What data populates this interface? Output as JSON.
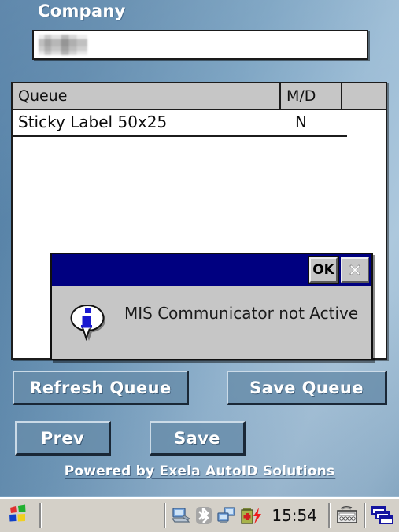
{
  "app": {
    "company": {
      "label": "Company",
      "value": "",
      "value_redacted": true
    },
    "queue_table": {
      "columns": [
        "Queue",
        "M/D",
        ""
      ],
      "rows": [
        {
          "queue": "Sticky Label 50x25",
          "md": "N",
          "extra": ""
        }
      ]
    },
    "dialog": {
      "title": "",
      "message": "MIS Communicator not Active",
      "icon": "info-icon",
      "ok_label": "OK",
      "close_label": "×",
      "titlebar_color": "#000080",
      "body_color": "#c6c6c6"
    },
    "buttons": {
      "refresh_queue": "Refresh Queue",
      "save_queue": "Save Queue",
      "prev": "Prev",
      "save": "Save"
    },
    "footer": {
      "link_text": "Powered by Exela AutoID Solutions"
    },
    "theme": {
      "background_start": "#4e7ba3",
      "background_end": "#adc8dd",
      "button_face": "#688caa",
      "accent_text": "#ffffff"
    }
  },
  "taskbar": {
    "start_icon": "windows-flag-icon",
    "tray_icons": [
      "desktop-pc-icon",
      "bluetooth-icon",
      "network-connection-icon",
      "battery-charging-icon"
    ],
    "clock": "15:54",
    "sip_icon": "keyboard-icon",
    "window_list_icon": "window-stack-icon"
  }
}
